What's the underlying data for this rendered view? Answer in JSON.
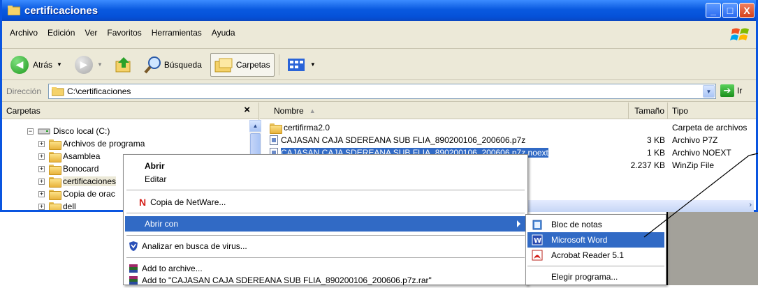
{
  "window": {
    "title": "certificaciones",
    "controls": {
      "minimize": "_",
      "maximize": "□",
      "close": "X"
    }
  },
  "menubar": {
    "items": [
      "Archivo",
      "Edición",
      "Ver",
      "Favoritos",
      "Herramientas",
      "Ayuda"
    ]
  },
  "toolbar": {
    "back_label": "Atrás",
    "search_label": "Búsqueda",
    "folders_label": "Carpetas"
  },
  "address": {
    "label": "Dirección",
    "value": "C:\\certificaciones",
    "go_label": "Ir"
  },
  "tree": {
    "header": "Carpetas",
    "close_glyph": "×",
    "items": [
      {
        "label": "Disco local (C:)",
        "type": "drive"
      },
      {
        "label": "Archivos de programa"
      },
      {
        "label": "Asamblea"
      },
      {
        "label": "Bonocard"
      },
      {
        "label": "certificaciones"
      },
      {
        "label": "Copia de orac"
      },
      {
        "label": "dell"
      }
    ]
  },
  "files": {
    "columns": {
      "name": "Nombre",
      "size": "Tamaño",
      "type": "Tipo"
    },
    "rows": [
      {
        "name": "certifirma2.0",
        "size": "",
        "type": "Carpeta de archivos"
      },
      {
        "name": "CAJASAN CAJA SDEREANA SUB FLIA_890200106_200606.p7z",
        "size": "3 KB",
        "type": "Archivo P7Z"
      },
      {
        "name": "CAJASAN CAJA SDEREANA SUB FLIA_890200106_200606.p7z.noext",
        "size": "1 KB",
        "type": "Archivo NOEXT"
      },
      {
        "name": "",
        "size": "2.237 KB",
        "type": "WinZip File"
      }
    ]
  },
  "context_menu": {
    "open": "Abrir",
    "edit": "Editar",
    "netware": "Copia de NetWare...",
    "open_with": "Abrir con",
    "scan": "Analizar en busca de virus...",
    "add_archive": "Add to archive...",
    "add_named": "Add to \"CAJASAN CAJA SDEREANA SUB FLIA_890200106_200606.p7z.rar\""
  },
  "submenu": {
    "notepad": "Bloc de notas",
    "word": "Microsoft Word",
    "acrobat": "Acrobat Reader 5.1",
    "choose": "Elegir programa..."
  },
  "colors": {
    "titlebar": "#0a5ae0",
    "selection": "#316ac5",
    "chrome": "#ece9d8"
  }
}
